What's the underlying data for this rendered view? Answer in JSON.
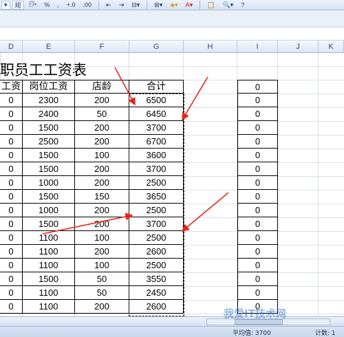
{
  "toolbar": {
    "items": [
      {
        "name": "dropdown-arrow-button",
        "label": "▾",
        "boxed": true
      },
      {
        "name": "style-dropdown",
        "label": "规",
        "boxed": true
      },
      {
        "name": "currency-button",
        "label": "🗊▾",
        "boxed": false
      },
      {
        "name": "percent-button",
        "label": "%",
        "boxed": false
      },
      {
        "name": "comma-button",
        "label": ",",
        "boxed": false
      },
      {
        "name": "increase-decimal-button",
        "label": "+.0",
        "boxed": false
      },
      {
        "name": "decrease-decimal-button",
        "label": ".00",
        "boxed": false
      },
      {
        "name": "sep",
        "label": ""
      },
      {
        "name": "decrease-indent-button",
        "label": "⇤",
        "boxed": false
      },
      {
        "name": "increase-indent-button",
        "label": "⇥",
        "boxed": false
      },
      {
        "name": "merge-button",
        "label": "⊟▾",
        "boxed": false
      },
      {
        "name": "sep",
        "label": ""
      },
      {
        "name": "border-button",
        "label": "⊞▾",
        "boxed": false
      },
      {
        "name": "fill-color-button",
        "label": "◈▾",
        "boxed": false
      },
      {
        "name": "font-color-button",
        "label": "A▾",
        "boxed": false
      },
      {
        "name": "sep",
        "label": ""
      },
      {
        "name": "paste-button",
        "label": "📋",
        "boxed": false
      },
      {
        "name": "zoom-button",
        "label": "🔍▾",
        "boxed": false
      },
      {
        "name": "help-button",
        "label": "?",
        "boxed": false
      }
    ]
  },
  "columns": [
    "D",
    "E",
    "F",
    "G",
    "H",
    "I",
    "J",
    "K"
  ],
  "sheet": {
    "title": "职员工工资表",
    "headers": [
      "工资",
      "岗位工资",
      "店龄",
      "合计"
    ],
    "rows": [
      [
        "0",
        "2300",
        "200",
        "6500"
      ],
      [
        "0",
        "2400",
        "50",
        "6450"
      ],
      [
        "0",
        "1500",
        "200",
        "3700"
      ],
      [
        "0",
        "2500",
        "200",
        "6700"
      ],
      [
        "0",
        "1500",
        "100",
        "3600"
      ],
      [
        "0",
        "1500",
        "200",
        "3700"
      ],
      [
        "0",
        "1000",
        "200",
        "2500"
      ],
      [
        "0",
        "1500",
        "150",
        "3650"
      ],
      [
        "0",
        "1000",
        "200",
        "2500"
      ],
      [
        "0",
        "1500",
        "200",
        "3700"
      ],
      [
        "0",
        "1100",
        "100",
        "2500"
      ],
      [
        "0",
        "1100",
        "200",
        "2600"
      ],
      [
        "0",
        "1100",
        "100",
        "2500"
      ],
      [
        "0",
        "1500",
        "50",
        "3550"
      ],
      [
        "0",
        "1100",
        "50",
        "2450"
      ],
      [
        "0",
        "1100",
        "200",
        "2600"
      ]
    ],
    "i_column": [
      "0",
      "0",
      "0",
      "0",
      "0",
      "0",
      "0",
      "0",
      "0",
      "0",
      "0",
      "0",
      "0",
      "0",
      "0",
      "0",
      "0"
    ]
  },
  "status": {
    "average": "平均值: 3700",
    "count": "计数: 1"
  },
  "watermark": "我爱IT技术网",
  "colors": {
    "arrow": "#e8251c",
    "toolbar": "#dbe5f4",
    "grid_line": "#d9dfe8"
  }
}
